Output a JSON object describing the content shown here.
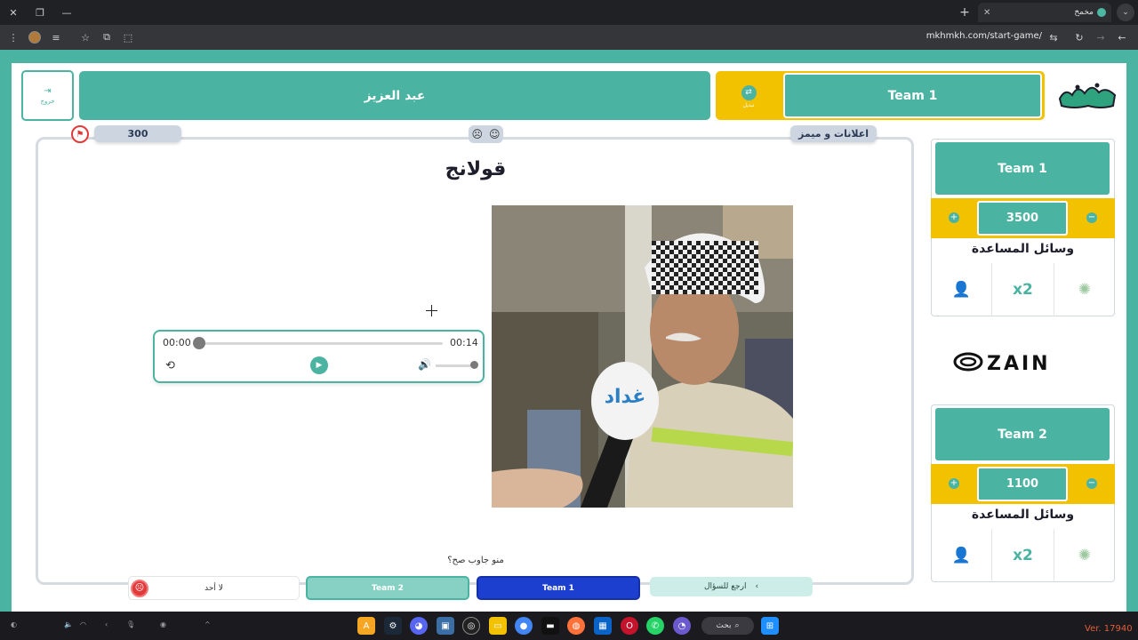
{
  "browser": {
    "tab_title": "مخمخ",
    "url": "mkhmkh.com/start-game/"
  },
  "header": {
    "exit_label": "خروج",
    "player_name": "عبد العزيز",
    "swap_label": "تبديل",
    "current_team": "Team 1"
  },
  "question": {
    "points": "300",
    "category": "اعلانات و ميمز",
    "title": "قولانج",
    "who_answered": "منو جاوب صح؟",
    "answers": {
      "none": "لا أحد",
      "team2": "Team 2",
      "team1": "Team 1",
      "back": "ارجع للسؤال"
    }
  },
  "audio": {
    "current": "00:00",
    "duration": "00:14",
    "progress": 0,
    "volume": 1
  },
  "teams": [
    {
      "name": "Team 1",
      "score": "3500",
      "helps_title": "وسائل المساعدة"
    },
    {
      "name": "Team 2",
      "score": "1100",
      "helps_title": "وسائل المساعدة"
    }
  ],
  "sponsor": "ZAIN",
  "taskbar": {
    "search_label": "بحث",
    "version": "Ver. 17940"
  },
  "colors": {
    "accent": "#4ab3a1",
    "highlight": "#f2c200",
    "team1_answer": "#1d3fd0",
    "danger": "#e23a3a"
  }
}
